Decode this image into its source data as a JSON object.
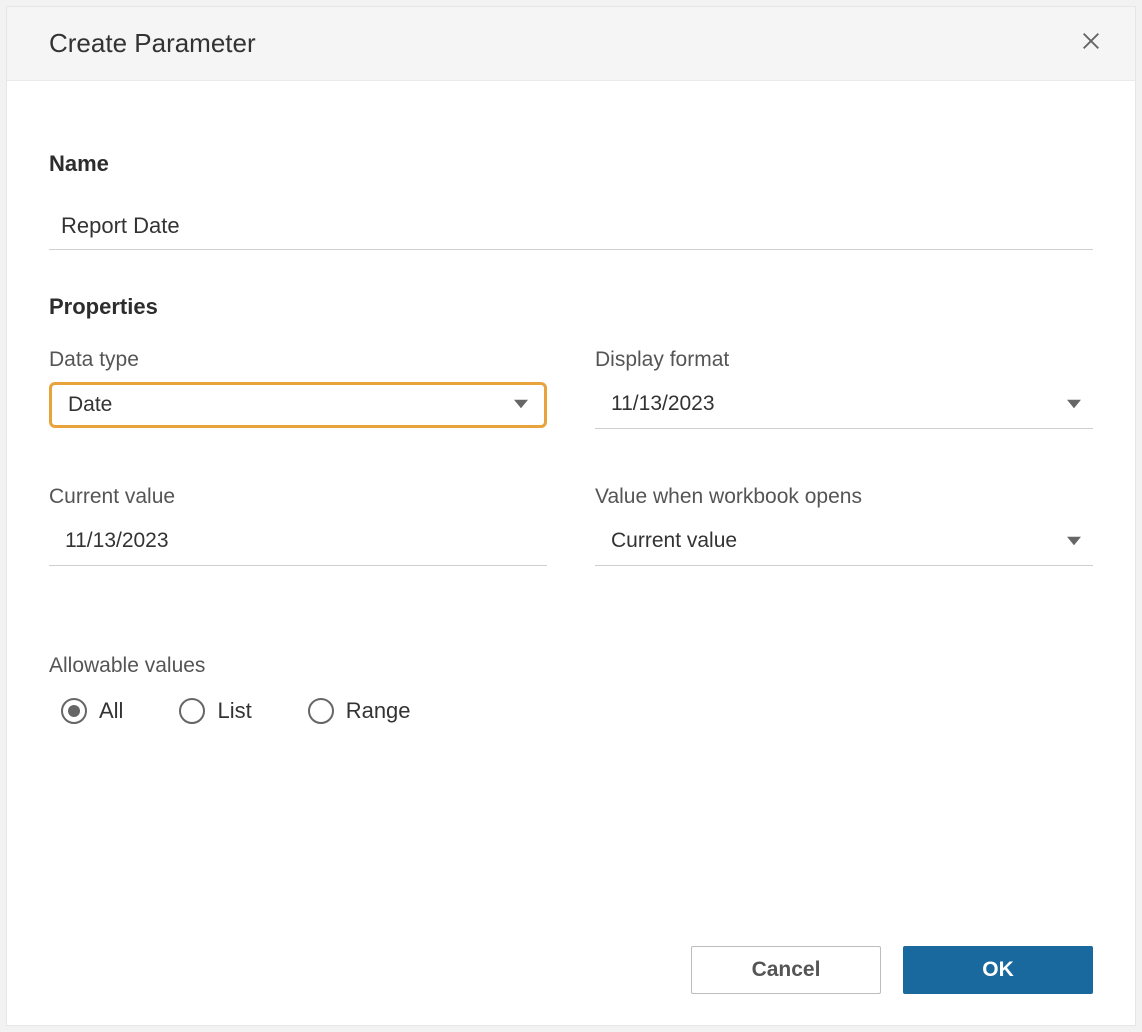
{
  "dialog": {
    "title": "Create Parameter"
  },
  "name_section": {
    "label": "Name",
    "value": "Report Date"
  },
  "properties": {
    "label": "Properties",
    "data_type": {
      "label": "Data type",
      "value": "Date"
    },
    "display_format": {
      "label": "Display format",
      "value": "11/13/2023"
    },
    "current_value": {
      "label": "Current value",
      "value": "11/13/2023"
    },
    "value_on_open": {
      "label": "Value when workbook opens",
      "value": "Current value"
    }
  },
  "allowable": {
    "label": "Allowable values",
    "options": {
      "all": "All",
      "list": "List",
      "range": "Range"
    },
    "selected": "all"
  },
  "footer": {
    "cancel": "Cancel",
    "ok": "OK"
  }
}
